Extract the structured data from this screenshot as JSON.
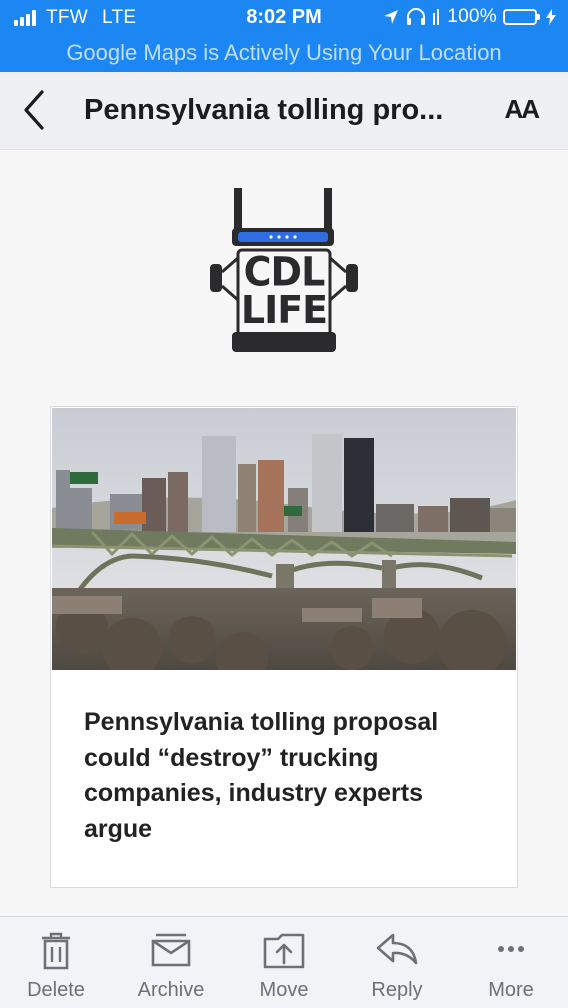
{
  "status_bar": {
    "carrier": "TFW",
    "network": "LTE",
    "time": "8:02 PM",
    "battery": "100%",
    "banner": "Google Maps is Actively Using Your Location"
  },
  "nav": {
    "title": "Pennsylvania tolling pro...",
    "text_size_button": "AA"
  },
  "logo": {
    "line1": "CDL",
    "line2": "LIFE"
  },
  "article_card": {
    "headline": "Pennsylvania tolling proposal could “destroy” trucking companies, industry experts argue"
  },
  "toolbar": {
    "items": [
      {
        "label": "Delete",
        "icon": "trash-icon"
      },
      {
        "label": "Archive",
        "icon": "archive-icon"
      },
      {
        "label": "Move",
        "icon": "move-icon"
      },
      {
        "label": "Reply",
        "icon": "reply-icon"
      },
      {
        "label": "More",
        "icon": "more-icon"
      }
    ]
  },
  "colors": {
    "status_bar": "#1c86f2",
    "toolbar_icons": "#6e7078",
    "logo_dark": "#2b2b2d",
    "logo_accent": "#2f6ee0"
  }
}
